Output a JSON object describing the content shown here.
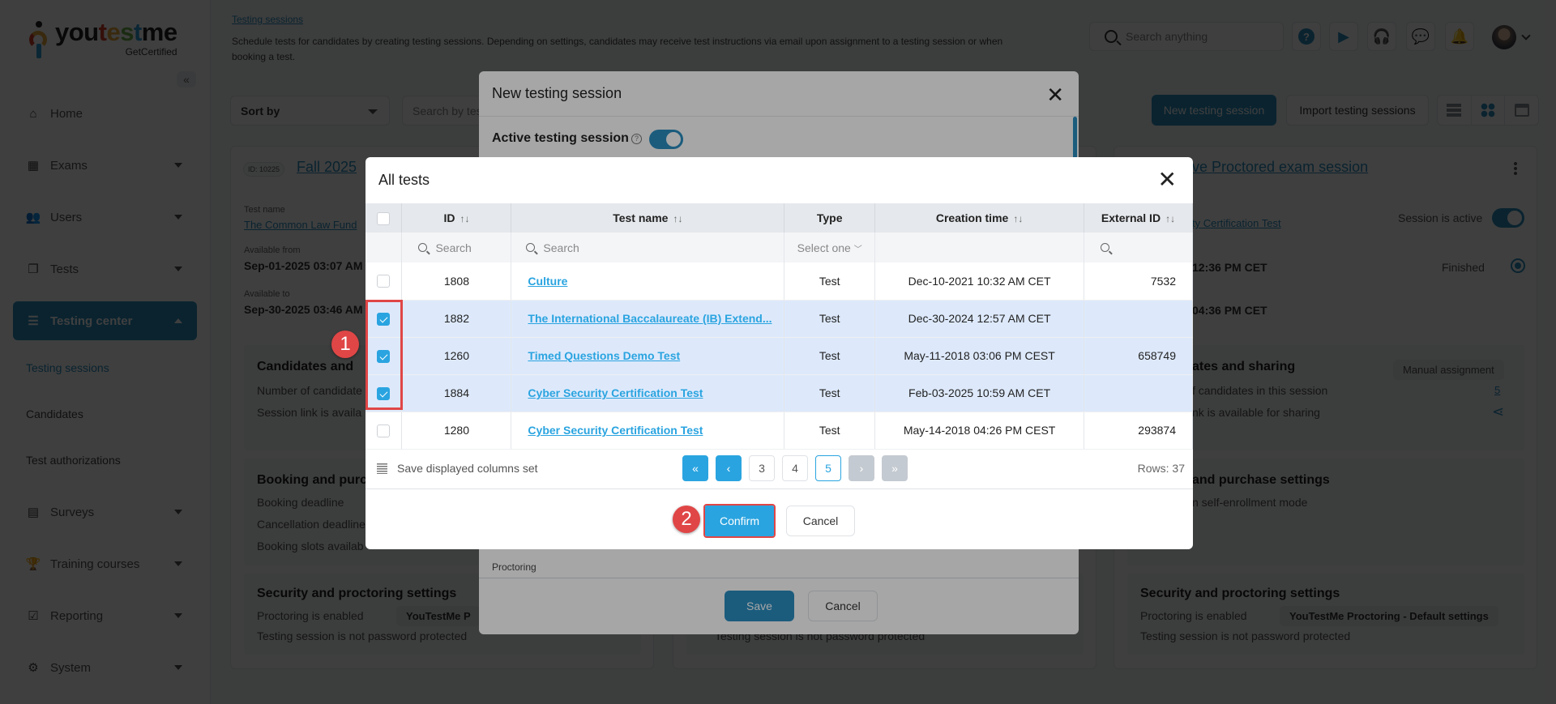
{
  "logo": {
    "word_parts": [
      "you",
      "t",
      "e",
      "s",
      "t",
      "me"
    ],
    "sub": "GetCertified"
  },
  "sidebar": {
    "items": [
      {
        "label": "Home",
        "icon": "home-icon",
        "glyph": "⌂"
      },
      {
        "label": "Exams",
        "icon": "exams-icon",
        "glyph": "▦"
      },
      {
        "label": "Users",
        "icon": "users-icon",
        "glyph": "👥"
      },
      {
        "label": "Tests",
        "icon": "tests-icon",
        "glyph": "❐"
      },
      {
        "label": "Testing center",
        "icon": "testing-center-icon",
        "glyph": "☰"
      },
      {
        "label": "Surveys",
        "icon": "surveys-icon",
        "glyph": "▤"
      },
      {
        "label": "Training courses",
        "icon": "trophy-icon",
        "glyph": "🏆"
      },
      {
        "label": "Reporting",
        "icon": "reporting-icon",
        "glyph": "☑"
      },
      {
        "label": "System",
        "icon": "gear-icon",
        "glyph": "⚙"
      }
    ],
    "sub_items": [
      "Testing sessions",
      "Candidates",
      "Test authorizations"
    ],
    "collapse_glyph": "«"
  },
  "header": {
    "breadcrumb": "Testing sessions",
    "description": "Schedule tests for candidates by creating testing sessions. Depending on settings, candidates may receive test instructions via email upon assignment to a testing session or when booking a test.",
    "search_placeholder": "Search anything",
    "help_glyph": "?",
    "play_glyph": "▶",
    "support_glyph": "🎧",
    "chat_glyph": "💬",
    "bell_glyph": "🔔"
  },
  "toolbar": {
    "sort_label": "Sort by",
    "search_placeholder": "Search by test",
    "new_label": "New testing session",
    "import_label": "Import testing sessions"
  },
  "card_left": {
    "id": "ID: 10225",
    "title": "Fall 2025",
    "test_name_label": "Test name",
    "test_name": "The Common Law Fund",
    "from_label": "Available from",
    "from": "Sep-01-2025 03:07 AM",
    "to_label": "Available to",
    "to": "Sep-30-2025 03:46 AM",
    "cand_h": "Candidates and",
    "cand_t1": "Number of candidate",
    "cand_t2": "Session link is availa",
    "book_h": "Booking and purch",
    "book_t1": "Booking deadline",
    "book_t2": "Cancellation deadline",
    "book_t3": "Booking slots availab",
    "sec_h": "Security and proctoring settings",
    "sec_t1": "Proctoring is enabled",
    "sec_chip": "YouTestMe P",
    "sec_t2": "Testing session is not password protected"
  },
  "card_mid": {
    "sec_t2": "Testing session is not password protected"
  },
  "card_right": {
    "title": "ve Proctored exam session",
    "test_link": "ty Certification Test",
    "active_label": "Session is active",
    "time1": "12:36 PM CET",
    "status": "Finished",
    "time2": "04:36 PM CET",
    "cand_h": "ates and sharing",
    "manual": "Manual assignment",
    "cand_t1": "f candidates in this session",
    "cand_count": "5",
    "cand_t2": "nk is available for sharing",
    "book_h": "and purchase settings",
    "book_t1": "n self-enrollment mode",
    "sec_h": "Security and proctoring settings",
    "sec_t1": "Proctoring is enabled",
    "sec_chip": "YouTestMe Proctoring - Default settings",
    "sec_t2": "Testing session is not password protected"
  },
  "back_modal": {
    "title": "New testing session",
    "active_label": "Active testing session",
    "proctoring": "Proctoring",
    "save": "Save",
    "cancel": "Cancel"
  },
  "modal": {
    "title": "All tests",
    "columns": [
      "ID",
      "Test name",
      "Type",
      "Creation time",
      "External ID"
    ],
    "filters": {
      "id": "Search",
      "name": "Search",
      "type": "Select one"
    },
    "rows": [
      {
        "id": "1808",
        "name": "Culture",
        "type": "Test",
        "created": "Dec-10-2021 10:32 AM CET",
        "ext": "7532",
        "selected": false
      },
      {
        "id": "1882",
        "name": "The International Baccalaureate (IB) Extend...",
        "type": "Test",
        "created": "Dec-30-2024 12:57 AM CET",
        "ext": "",
        "selected": true
      },
      {
        "id": "1260",
        "name": "Timed Questions Demo Test",
        "type": "Test",
        "created": "May-11-2018 03:06 PM CEST",
        "ext": "658749",
        "selected": true
      },
      {
        "id": "1884",
        "name": "Cyber Security Certification Test",
        "type": "Test",
        "created": "Feb-03-2025 10:59 AM CET",
        "ext": "",
        "selected": true
      },
      {
        "id": "1280",
        "name": "Cyber Security Certification Test",
        "type": "Test",
        "created": "May-14-2018 04:26 PM CEST",
        "ext": "293874",
        "selected": false
      }
    ],
    "save_columns": "Save displayed columns set",
    "pager": {
      "first": "«",
      "prev": "‹",
      "pages": [
        "3",
        "4",
        "5"
      ],
      "current": "5",
      "next": "›",
      "last": "»"
    },
    "rows_count": "Rows: 37",
    "confirm": "Confirm",
    "cancel": "Cancel"
  },
  "annotations": [
    "1",
    "2"
  ]
}
